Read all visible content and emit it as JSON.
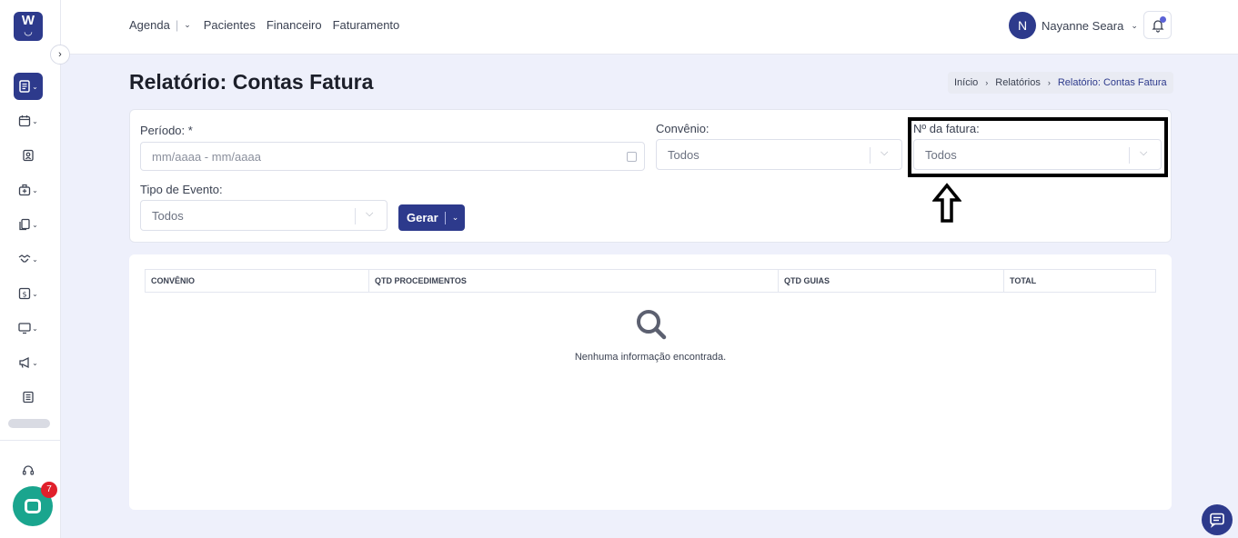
{
  "app": {
    "logo_letter": "W"
  },
  "nav": {
    "items": [
      "Agenda",
      "Pacientes",
      "Financeiro",
      "Faturamento"
    ],
    "agenda_sep": "|"
  },
  "user": {
    "initial": "N",
    "name": "Nayanne Seara"
  },
  "chat": {
    "badge_count": "7"
  },
  "page": {
    "title": "Relatório: Contas Fatura"
  },
  "breadcrumb": {
    "items": [
      "Início",
      "Relatórios",
      "Relatório: Contas Fatura"
    ]
  },
  "filters": {
    "periodo": {
      "label": "Período: *",
      "placeholder": "mm/aaaa - mm/aaaa"
    },
    "convenio": {
      "label": "Convênio:",
      "value": "Todos"
    },
    "fatura": {
      "label": "Nº da fatura:",
      "value": "Todos"
    },
    "tipo_evento": {
      "label": "Tipo de Evento:",
      "value": "Todos"
    },
    "gerar_label": "Gerar"
  },
  "table": {
    "columns": [
      "CONVÊNIO",
      "QTD PROCEDIMENTOS",
      "QTD GUIAS",
      "TOTAL"
    ],
    "empty_message": "Nenhuma informação encontrada."
  },
  "colors": {
    "brand": "#2d3a8c",
    "chat": "#1aa58e",
    "badge": "#e0202b",
    "background": "#eef0fb"
  }
}
